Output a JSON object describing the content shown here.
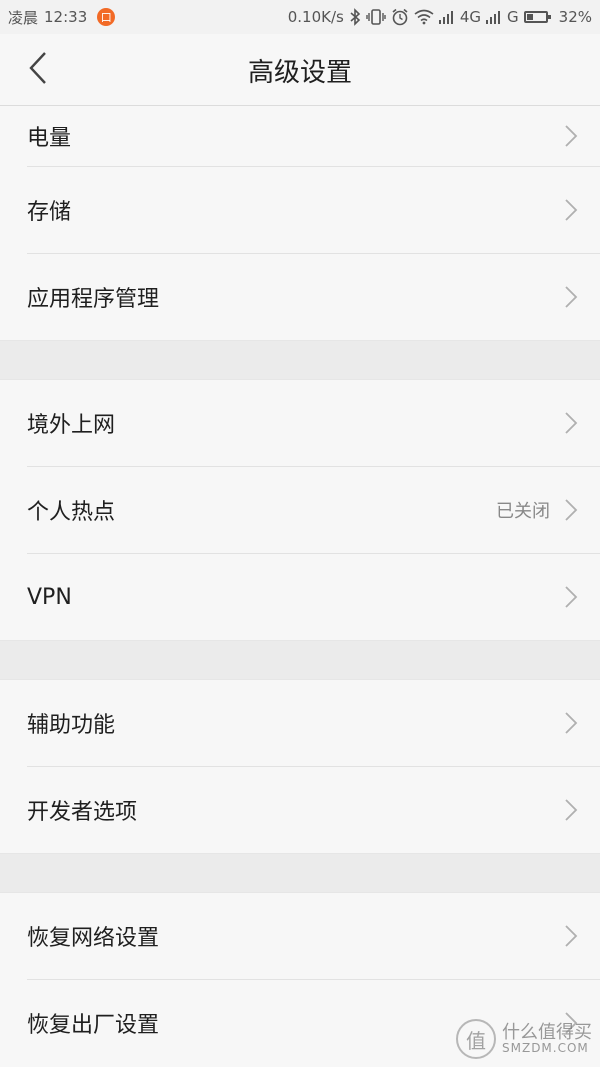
{
  "status_bar": {
    "time_period": "凌晨",
    "time": "12:33",
    "app_badge": "口",
    "net_speed": "0.10K/s",
    "signal1_label": "4G",
    "signal2_label": "G",
    "battery_percent_text": "32%",
    "battery_level": 0.32
  },
  "header": {
    "title": "高级设置",
    "back_icon": "chevron-left-icon"
  },
  "sections": [
    {
      "items": [
        {
          "label": "电量"
        },
        {
          "label": "存储"
        },
        {
          "label": "应用程序管理"
        }
      ]
    },
    {
      "items": [
        {
          "label": "境外上网"
        },
        {
          "label": "个人热点",
          "value": "已关闭"
        },
        {
          "label": "VPN"
        }
      ]
    },
    {
      "items": [
        {
          "label": "辅助功能"
        },
        {
          "label": "开发者选项"
        }
      ]
    },
    {
      "items": [
        {
          "label": "恢复网络设置"
        },
        {
          "label": "恢复出厂设置"
        }
      ]
    }
  ],
  "watermark": {
    "badge_char": "值",
    "line1": "什么值得买",
    "line2": "SMZDM.COM"
  },
  "colors": {
    "background": "#f7f7f7",
    "section_gap": "#ebebeb",
    "app_badge": "#f26a26",
    "chevron": "#b0b0b0"
  }
}
